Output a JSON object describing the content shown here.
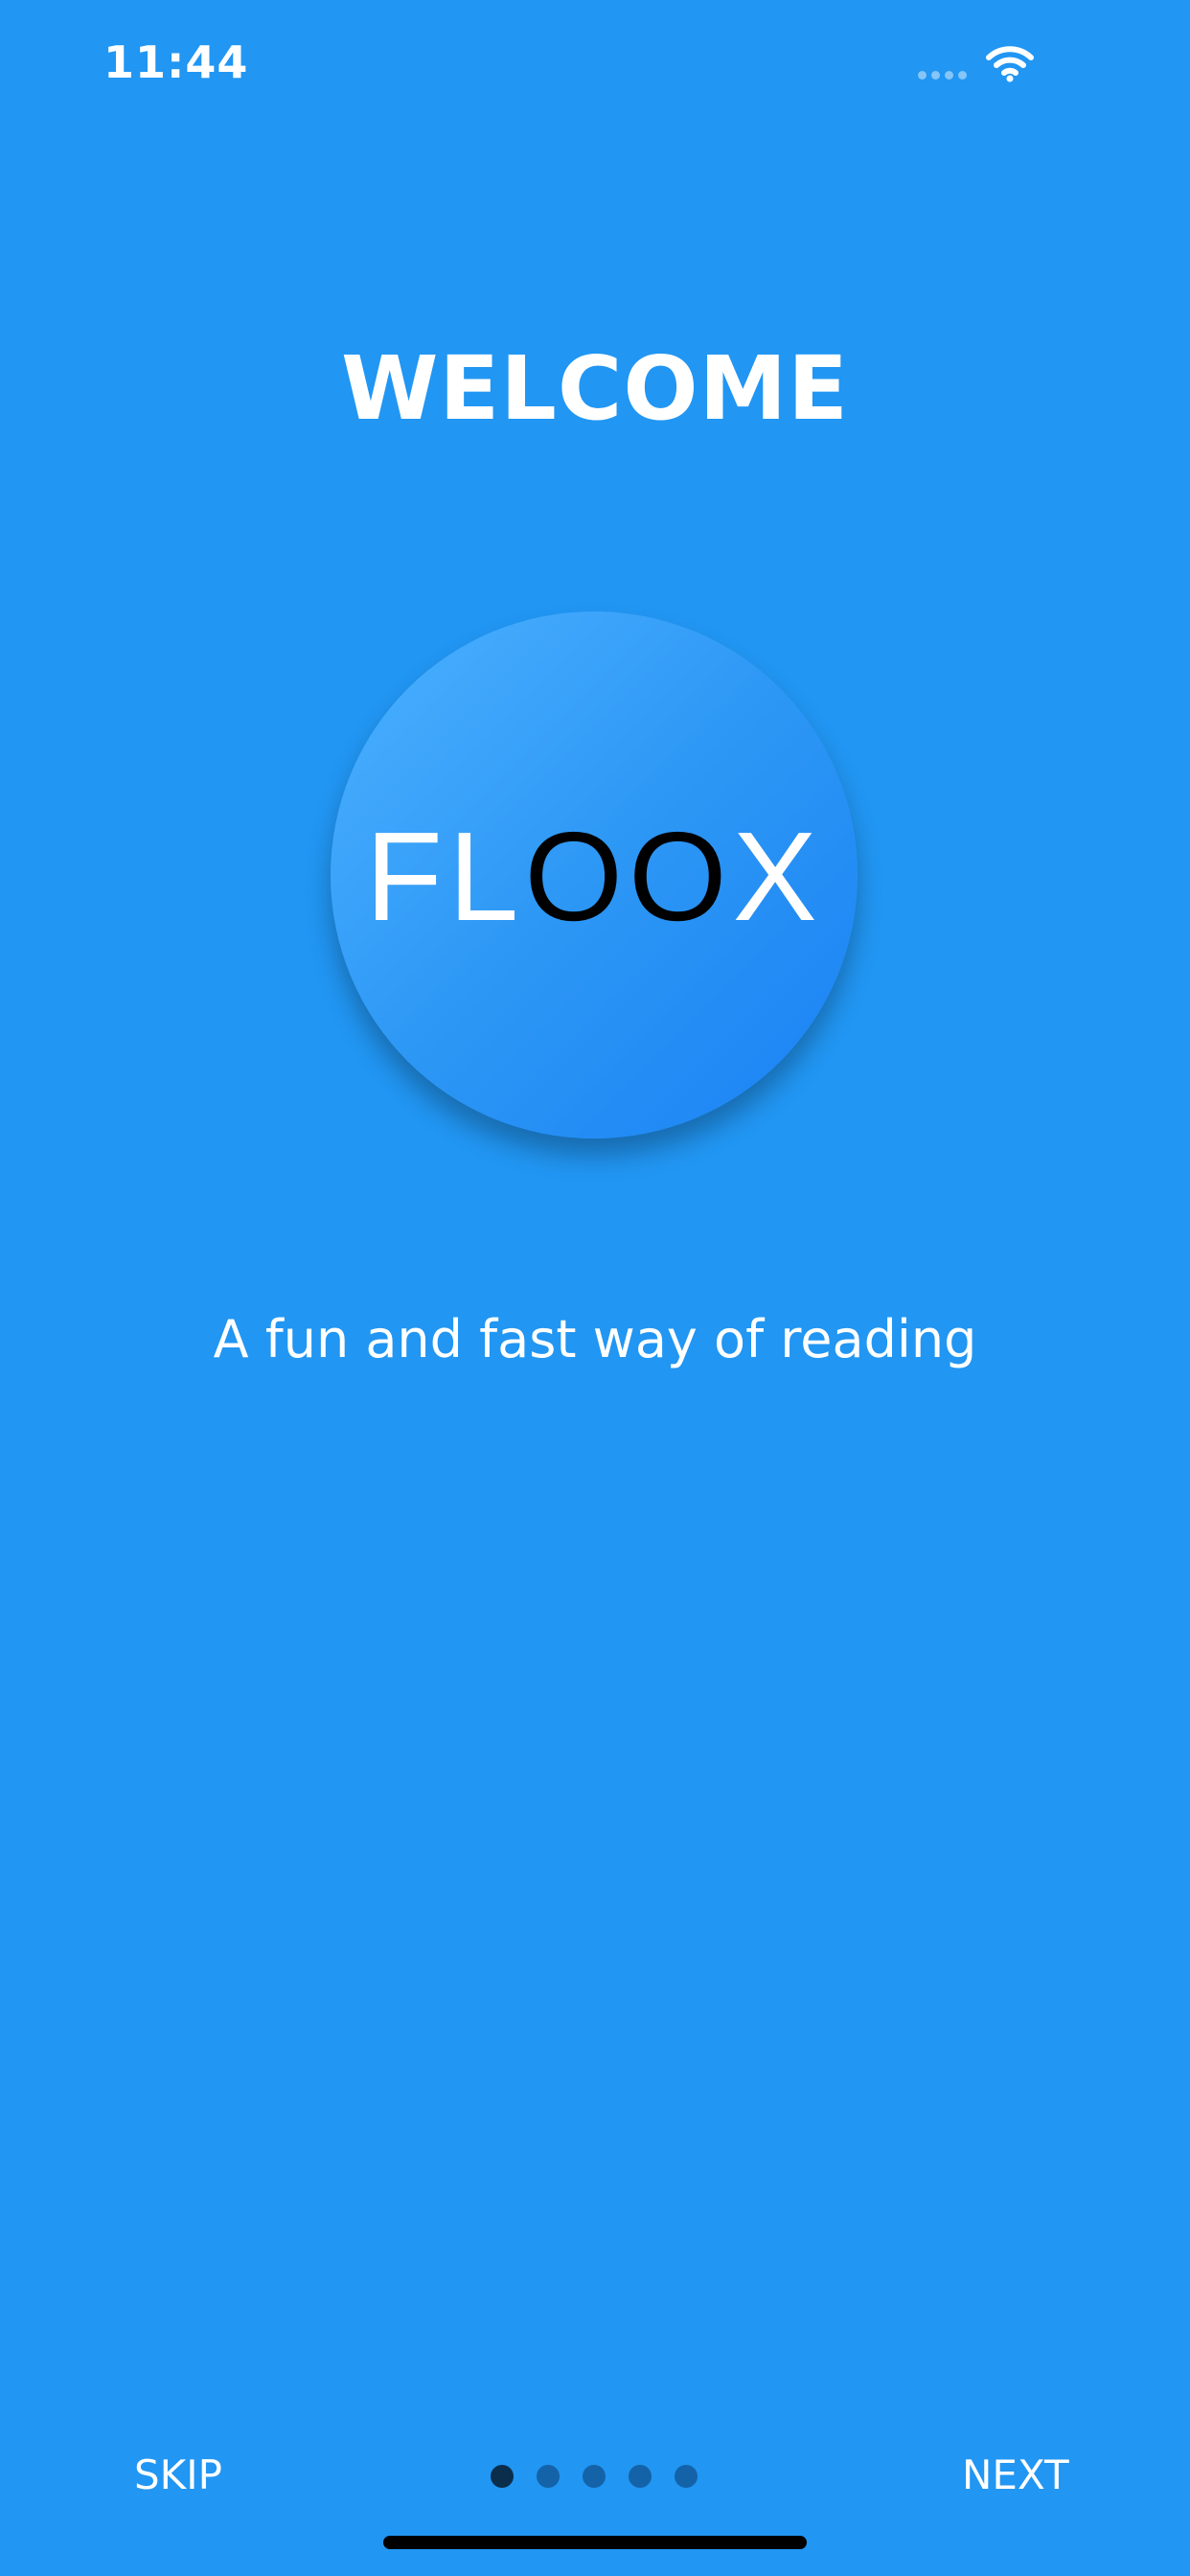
{
  "status_bar": {
    "time": "11:44",
    "wifi_icon": "wifi-icon",
    "signal_icon": "cellular-signal-icon"
  },
  "header": {
    "title": "WELCOME"
  },
  "logo": {
    "letters_white": "FL",
    "letters_dark": "OO",
    "letter_end": "X",
    "colors": {
      "gradient_start": "#4CB2FF",
      "gradient_end": "#1A82F5",
      "white_letters": "#FFFFFF",
      "dark_letters": "#000000"
    }
  },
  "main": {
    "tagline": "A fun and fast way of reading"
  },
  "footer": {
    "skip_label": "SKIP",
    "next_label": "NEXT",
    "page_count": 5,
    "current_page": 1
  },
  "colors": {
    "background": "#2196F3",
    "dot_active": "#0B2E4C",
    "dot_inactive": "#1463A8"
  }
}
